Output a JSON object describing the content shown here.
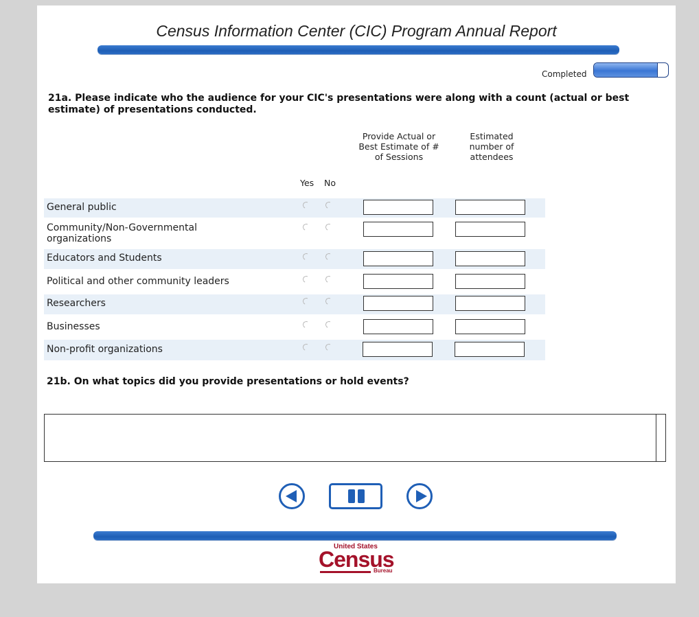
{
  "header": {
    "title": "Census Information Center (CIC) Program Annual Report",
    "completed_label": "Completed",
    "progress_fraction": 0.85
  },
  "q21a": {
    "text": "21a. Please indicate who the audience for your CIC's presentations were along with a count (actual or best estimate) of presentations conducted.",
    "col_yes": "Yes",
    "col_no": "No",
    "col_sessions": "Provide Actual or Best Estimate of # of Sessions",
    "col_attendees": "Estimated number of attendees",
    "rows": [
      {
        "label": "General public"
      },
      {
        "label": "Community/Non-Governmental organizations"
      },
      {
        "label": "Educators and Students"
      },
      {
        "label": "Political and other community leaders"
      },
      {
        "label": "Researchers"
      },
      {
        "label": "Businesses"
      },
      {
        "label": "Non-profit organizations"
      }
    ]
  },
  "q21b": {
    "text": "21b. On what topics did you provide presentations or hold events?",
    "answer": ""
  },
  "nav": {
    "prev_icon": "arrow-left-icon",
    "pause_icon": "pause-icon",
    "next_icon": "arrow-right-icon"
  },
  "footer": {
    "logo_top": "United States",
    "logo_main": "Census",
    "logo_bottom": "Bureau",
    "logo_color": "#a4122a",
    "accent_color": "#1f5fb6"
  }
}
